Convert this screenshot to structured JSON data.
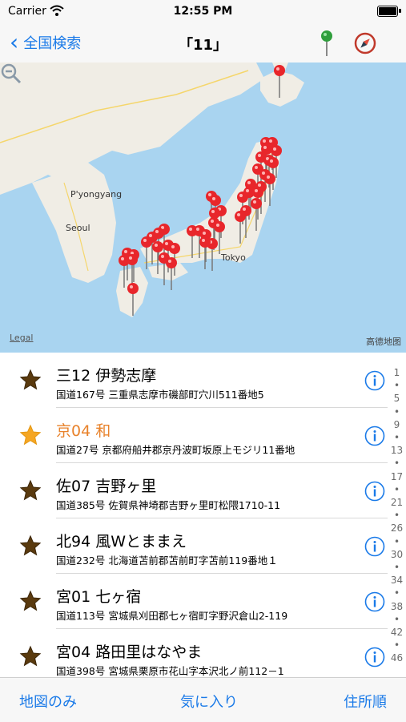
{
  "status": {
    "carrier": "Carrier",
    "time": "12:55 PM"
  },
  "nav": {
    "back_label": "全国検索",
    "title": "「11」",
    "icons": [
      "map-pin-icon",
      "compass-icon"
    ]
  },
  "map": {
    "labels": {
      "pyongyang": "P'yongyang",
      "seoul": "Seoul",
      "tokyo": "Tokyo"
    },
    "legal": "Legal",
    "attribution": "高德地图",
    "pin_color": "#e8262b",
    "pin_count": 44
  },
  "list": {
    "rows": [
      {
        "name": "三12 伊勢志摩",
        "address": "国道167号 三重県志摩市磯部町穴川511番地5",
        "starred": false
      },
      {
        "name": "京04 和",
        "address": "国道27号 京都府船井郡京丹波町坂原上モジリ11番地",
        "starred": true
      },
      {
        "name": "佐07 吉野ヶ里",
        "address": "国道385号 佐賀県神埼郡吉野ヶ里町松隈1710-11",
        "starred": false
      },
      {
        "name": "北94 風Wとままえ",
        "address": "国道232号 北海道苫前郡苫前町字苫前119番地１",
        "starred": false
      },
      {
        "name": "宮01 七ヶ宿",
        "address": "国道113号 宮城県刈田郡七ヶ宿町字野沢倉山2-119",
        "starred": false
      },
      {
        "name": "宮04 路田里はなやま",
        "address": "国道398号 宮城県栗原市花山字本沢北ノ前112－1",
        "starred": false
      }
    ],
    "colors": {
      "star_default": "#5a3a0e",
      "star_selected": "#f5a623",
      "selected_text": "#e8822b",
      "info": "#1a7ae8"
    }
  },
  "index": [
    "1",
    "•",
    "5",
    "•",
    "9",
    "•",
    "13",
    "•",
    "17",
    "•",
    "21",
    "•",
    "26",
    "•",
    "30",
    "•",
    "34",
    "•",
    "38",
    "•",
    "42",
    "•",
    "46"
  ],
  "toolbar": {
    "left": "地図のみ",
    "center": "気に入り",
    "right": "住所順"
  }
}
